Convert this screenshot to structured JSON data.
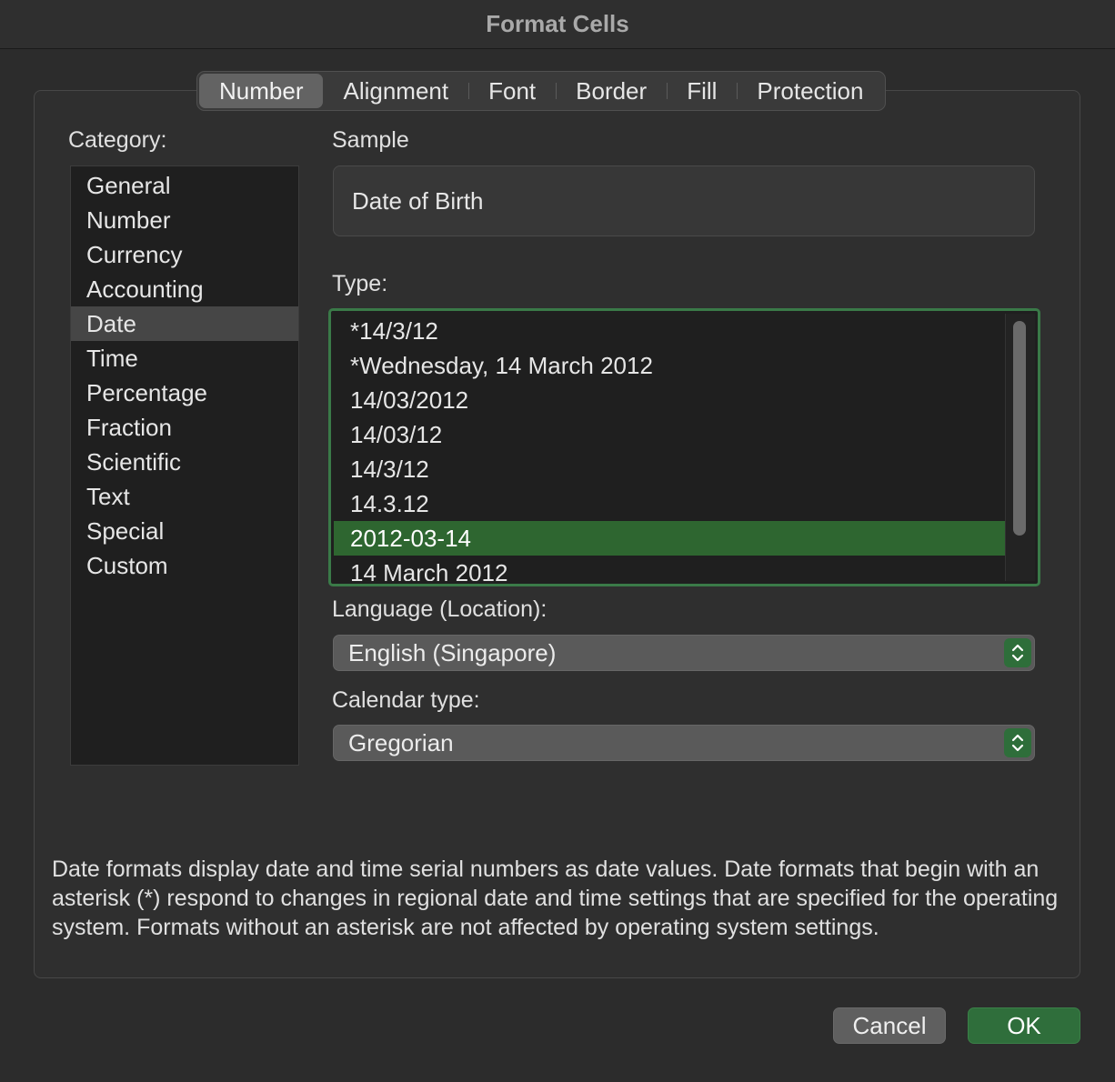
{
  "window": {
    "title": "Format Cells"
  },
  "tabs": [
    {
      "label": "Number",
      "active": true
    },
    {
      "label": "Alignment",
      "active": false
    },
    {
      "label": "Font",
      "active": false
    },
    {
      "label": "Border",
      "active": false
    },
    {
      "label": "Fill",
      "active": false
    },
    {
      "label": "Protection",
      "active": false
    }
  ],
  "category": {
    "label": "Category:",
    "items": [
      "General",
      "Number",
      "Currency",
      "Accounting",
      "Date",
      "Time",
      "Percentage",
      "Fraction",
      "Scientific",
      "Text",
      "Special",
      "Custom"
    ],
    "selected": "Date"
  },
  "sample": {
    "label": "Sample",
    "value": "Date of Birth"
  },
  "type": {
    "label": "Type:",
    "items": [
      "*14/3/12",
      "*Wednesday, 14 March 2012",
      "14/03/2012",
      "14/03/12",
      "14/3/12",
      "14.3.12",
      "2012-03-14",
      "14 March 2012"
    ],
    "selected": "2012-03-14"
  },
  "language": {
    "label": "Language (Location):",
    "value": "English (Singapore)"
  },
  "calendar": {
    "label": "Calendar type:",
    "value": "Gregorian"
  },
  "description": "Date formats display date and time serial numbers as date values.  Date formats that begin with an asterisk (*) respond to changes in regional date and time settings that are specified for the operating system. Formats without an asterisk are not affected by operating system settings.",
  "buttons": {
    "cancel": "Cancel",
    "ok": "OK"
  },
  "colors": {
    "accent": "#2e6630",
    "background": "#2c2c2c",
    "list_bg": "#1f1f1f"
  }
}
